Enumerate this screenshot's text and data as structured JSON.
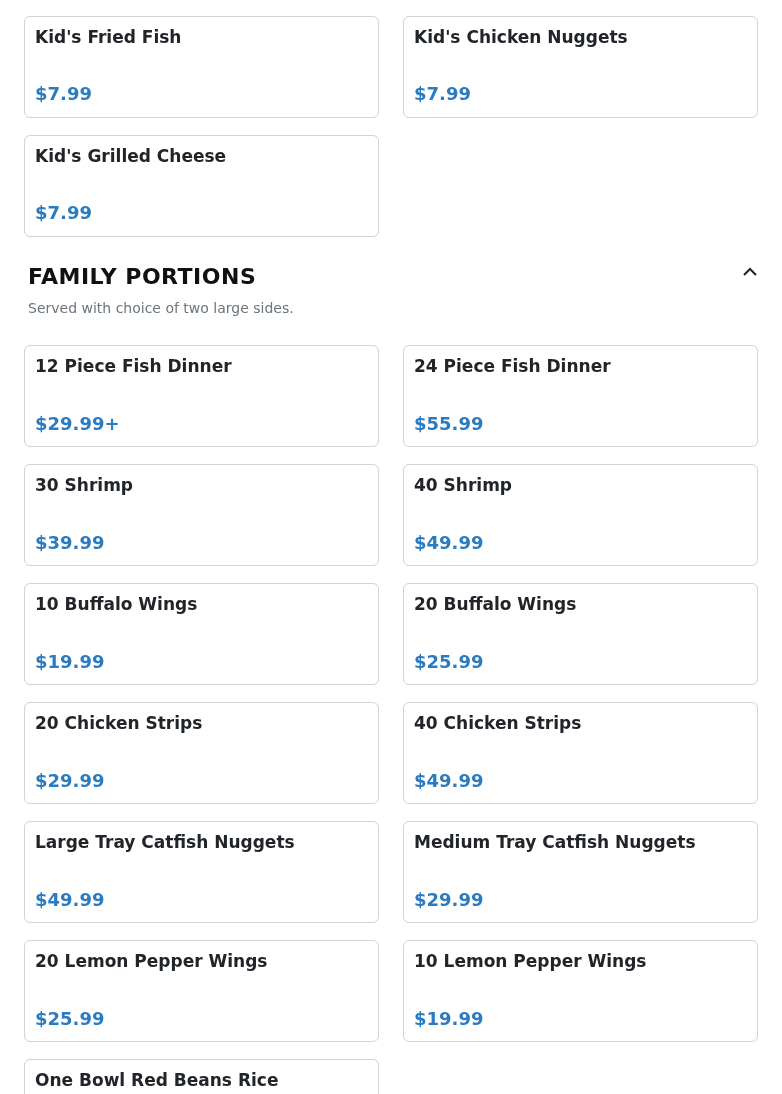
{
  "sections": [
    {
      "items": [
        {
          "name": "Kid's Fried Fish",
          "price": "$7.99"
        },
        {
          "name": "Kid's Chicken Nuggets",
          "price": "$7.99"
        },
        {
          "name": "Kid's Grilled Cheese",
          "price": "$7.99"
        }
      ]
    },
    {
      "title": "FAMILY PORTIONS",
      "description": "Served with choice of two large sides.",
      "expanded": true,
      "items": [
        {
          "name": "12 Piece Fish Dinner",
          "price": "$29.99+"
        },
        {
          "name": "24 Piece Fish Dinner",
          "price": "$55.99"
        },
        {
          "name": "30 Shrimp",
          "price": "$39.99"
        },
        {
          "name": "40 Shrimp",
          "price": "$49.99"
        },
        {
          "name": "10 Buffalo Wings",
          "price": "$19.99"
        },
        {
          "name": "20 Buffalo Wings",
          "price": "$25.99"
        },
        {
          "name": "20 Chicken Strips",
          "price": "$29.99"
        },
        {
          "name": "40 Chicken Strips",
          "price": "$49.99"
        },
        {
          "name": "Large Tray Catfish Nuggets",
          "price": "$49.99"
        },
        {
          "name": "Medium Tray Catfish Nuggets",
          "price": "$29.99"
        },
        {
          "name": "20 Lemon Pepper Wings",
          "price": "$25.99"
        },
        {
          "name": "10 Lemon Pepper Wings",
          "price": "$19.99"
        },
        {
          "name": "One Bowl Red Beans Rice"
        }
      ]
    }
  ]
}
